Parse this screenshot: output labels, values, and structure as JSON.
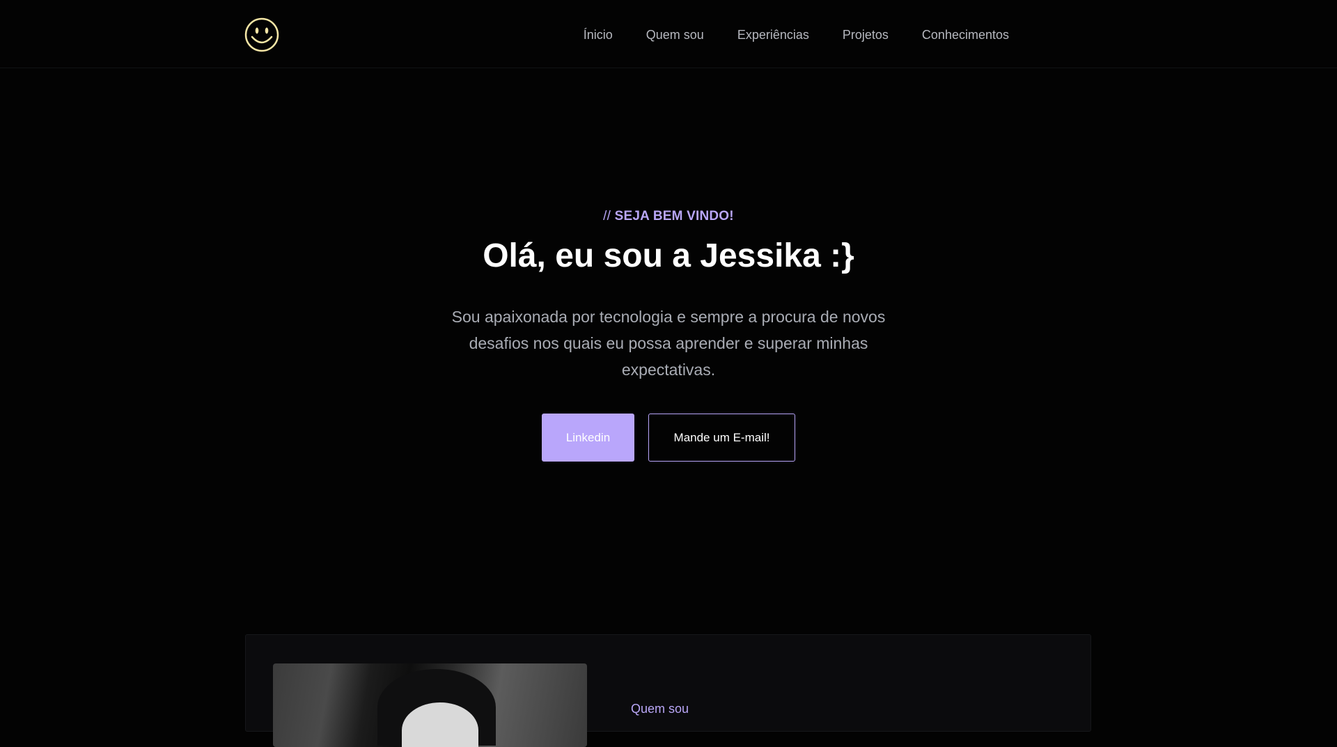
{
  "header": {
    "logo_icon": "smiley-face-icon",
    "logo_color": "#f5e6a6",
    "nav": [
      {
        "label": "Ínicio"
      },
      {
        "label": "Quem sou"
      },
      {
        "label": "Experiências"
      },
      {
        "label": "Projetos"
      },
      {
        "label": "Conhecimentos"
      }
    ]
  },
  "hero": {
    "eyebrow_prefix": "//",
    "eyebrow_text": "SEJA BEM VINDO!",
    "headline": "Olá, eu sou a Jessika :}",
    "tagline": "Sou apaixonada por tecnologia e sempre a procura de novos desafios nos quais eu possa aprender e superar minhas expectativas.",
    "primary_button": "Linkedin",
    "secondary_button": "Mande um E-mail!"
  },
  "about": {
    "label": "Quem sou"
  },
  "colors": {
    "background": "#030303",
    "accent": "#b9a6fb",
    "muted_text": "#a9acb4"
  }
}
